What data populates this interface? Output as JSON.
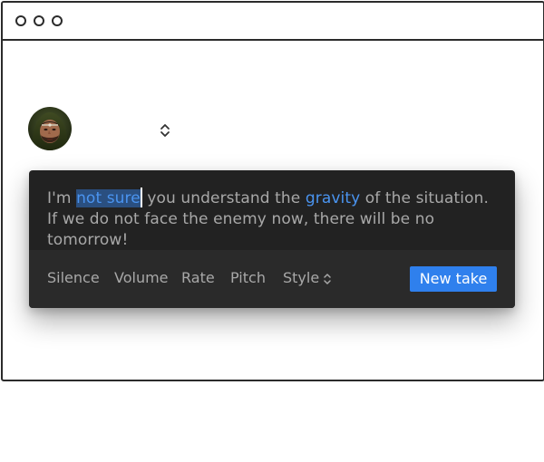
{
  "window": {
    "title": ""
  },
  "voice": {
    "avatar_icon": "character-portrait",
    "selected_voice": ""
  },
  "editor": {
    "text_before": "I'm ",
    "text_selected": "not sure",
    "text_middle": " you understand the ",
    "text_keyword": "gravity",
    "text_after": " of the situation. If we do not face the enemy now, there will be no tomorrow!"
  },
  "toolbar": {
    "silence": "Silence",
    "volume": "Volume",
    "rate": "Rate",
    "pitch": "Pitch",
    "style": "Style",
    "new_take": "New take"
  },
  "colors": {
    "editor_bg": "#222222",
    "toolbar_bg": "#2a2a2a",
    "accent": "#2f80ed",
    "highlight_text": "#4a94f0",
    "selection_bg": "#2a4f80",
    "text_muted": "#a8a8a8"
  }
}
